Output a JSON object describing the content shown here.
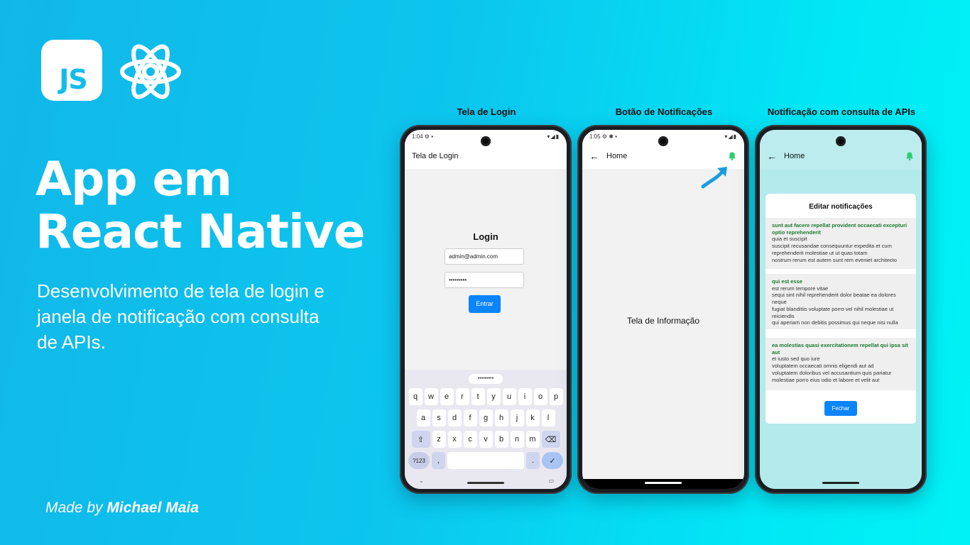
{
  "branding": {
    "js_logo_text": "JS",
    "headline_line1": "App em",
    "headline_line2": "React Native",
    "subtitle": "Desenvolvimento de tela de login e janela de notificação com consulta de APIs.",
    "credit_prefix": "Made by ",
    "credit_name": "Michael Maia"
  },
  "phones": {
    "login": {
      "label": "Tela de Login",
      "status_time": "1:04",
      "appbar_title": "Tela de Login",
      "form_title": "Login",
      "email_value": "admin@admin.com",
      "password_value": "•••••••••",
      "submit_label": "Entrar",
      "keyboard": {
        "suggestion": "•••••••••",
        "row1": [
          "q",
          "w",
          "e",
          "r",
          "t",
          "y",
          "u",
          "i",
          "o",
          "p"
        ],
        "row2": [
          "a",
          "s",
          "d",
          "f",
          "g",
          "h",
          "j",
          "k",
          "l"
        ],
        "row3": [
          "z",
          "x",
          "c",
          "v",
          "b",
          "n",
          "m"
        ],
        "numbers_key": "?123",
        "comma_key": ",",
        "period_key": ".",
        "enter_key": "✓"
      }
    },
    "home": {
      "label": "Botão de Notificações",
      "status_time": "1:05",
      "appbar_title": "Home",
      "body_text": "Tela de Informação"
    },
    "notifications": {
      "label": "Notificação com consulta de APIs",
      "appbar_title": "Home",
      "modal_title": "Editar notificações",
      "items": [
        {
          "title": "sunt aut facere repellat provident occaecati excepturi optio reprehenderit",
          "body": "quia et suscipit\nsuscipit recusandae consequuntur expedita et cum\nreprehenderit molestiae ut ut quas totam\nnostrum rerum est autem sunt rem eveniet architecto"
        },
        {
          "title": "qui est esse",
          "body": "est rerum tempore vitae\nsequi sint nihil reprehenderit dolor beatae ea dolores neque\nfugiat blanditiis voluptate porro vel nihil molestiae ut reiciendis\nqui aperiam non debitis possimus qui neque nisi nulla"
        },
        {
          "title": "ea molestias quasi exercitationem repellat qui ipsa sit aut",
          "body": "et iusto sed quo iure\nvoluptatem occaecati omnis eligendi aut ad\nvoluptatem doloribus vel accusantium quis pariatur\nmolestiae porro eius odio et labore et velit aut"
        }
      ],
      "close_label": "Fechar"
    }
  },
  "colors": {
    "accent_blue": "#0a84ff",
    "notif_title_green": "#1b7a2e",
    "bell_green": "#2ecc71",
    "react_logo": "#ffffff"
  }
}
